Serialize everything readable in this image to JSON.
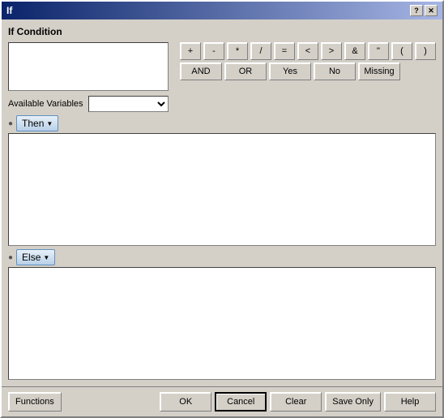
{
  "window": {
    "title": "If",
    "title_btn_help": "?",
    "title_btn_close": "✕"
  },
  "if_condition": {
    "label": "If Condition",
    "input_value": "",
    "input_placeholder": ""
  },
  "variables": {
    "label": "Available Variables",
    "options": []
  },
  "operators": {
    "row1": [
      "+",
      "-",
      "*",
      "/",
      "=",
      "<",
      ">",
      "&",
      "\"",
      "(",
      ")"
    ],
    "row2": [
      "AND",
      "OR",
      "Yes",
      "No",
      "Missing"
    ]
  },
  "then_section": {
    "label": "Then",
    "arrow": "▼"
  },
  "else_section": {
    "label": "Else",
    "arrow": "▼"
  },
  "bottom_buttons": {
    "functions": "Functions",
    "ok": "OK",
    "cancel": "Cancel",
    "clear": "Clear",
    "save_only": "Save Only",
    "help": "Help"
  }
}
